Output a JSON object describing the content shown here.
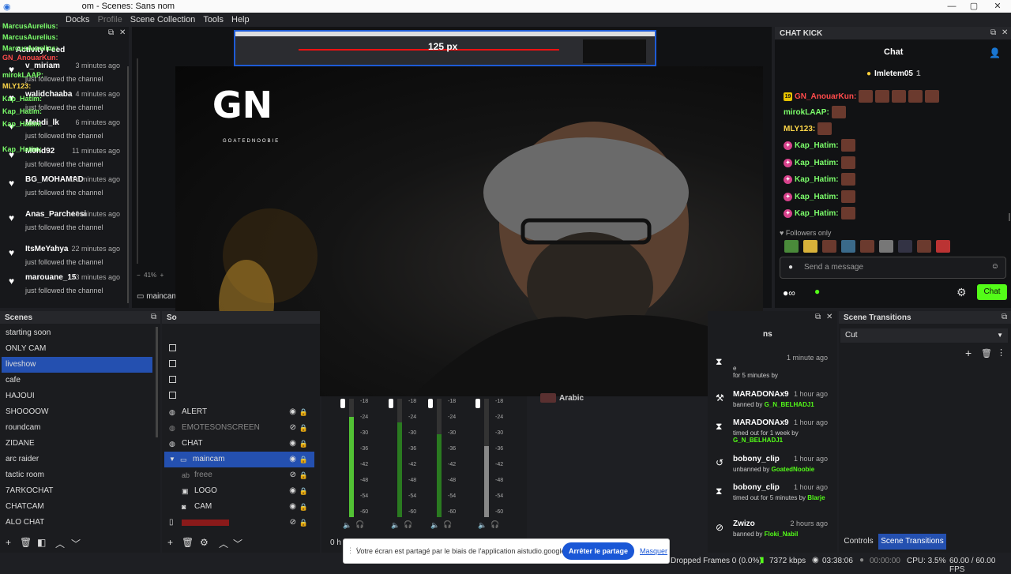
{
  "window": {
    "title": "Scenes: Sans nom",
    "title_prefix": "om - "
  },
  "menu": {
    "docks": "Docks",
    "profile": "Profile",
    "scene_collection": "Scene Collection",
    "tools": "Tools",
    "help": "Help"
  },
  "activity_feed": {
    "title": "Activity Feed",
    "items": [
      {
        "name": "v_miriam",
        "time": "3 minutes ago",
        "desc": "just followed the channel"
      },
      {
        "name": "walidchaaba",
        "time": "4 minutes ago",
        "desc": "just followed the channel"
      },
      {
        "name": "Mehdi_lk",
        "time": "6 minutes ago",
        "desc": "just followed the channel"
      },
      {
        "name": "M0hd92",
        "time": "11 minutes ago",
        "desc": "just followed the channel"
      },
      {
        "name": "BG_MOHAMAD",
        "time": "16 minutes ago",
        "desc": "just followed the channel"
      },
      {
        "name": "Anas_Parcheesi",
        "time": "19 minutes ago",
        "desc": "just followed the channel"
      },
      {
        "name": "ItsMeYahya",
        "time": "22 minutes ago",
        "desc": "just followed the channel"
      },
      {
        "name": "marouane_15",
        "time": "23 minutes ago",
        "desc": "just followed the channel"
      }
    ],
    "overlay_names": [
      "MarcusAurelius:",
      "MarcusAurelius:",
      "MarcusAurelius:",
      "GN_AnouarKun:",
      "mirokLAAP:",
      "MLY123:",
      "Kap_Hatim:",
      "Kap_Hatim:",
      "Kap_Hatim:",
      "Kap_Hatim:"
    ]
  },
  "preview": {
    "ruler_label": "125 px",
    "zoom": "41%",
    "source_label": "maincam"
  },
  "logo": {
    "letters": "GN",
    "caption": "GOATEDNOOBIE"
  },
  "chat": {
    "dock_title": "CHAT KICK",
    "header": "Chat",
    "pinned_user": "Imletem05",
    "pinned_count": "1",
    "lines": [
      {
        "badge": "19",
        "user": "GN_AnouarKun:",
        "color": "#ff4b4b",
        "emotes": 5
      },
      {
        "badge": "",
        "user": "mirokLAAP:",
        "color": "#7cff6b",
        "emotes": 1
      },
      {
        "badge": "",
        "user": "MLY123:",
        "color": "#ffd84a",
        "emotes": 1
      },
      {
        "badge": "g",
        "user": "Kap_Hatim:",
        "color": "#7cff6b",
        "emotes": 1
      },
      {
        "badge": "g",
        "user": "Kap_Hatim:",
        "color": "#7cff6b",
        "emotes": 1
      },
      {
        "badge": "g",
        "user": "Kap_Hatim:",
        "color": "#7cff6b",
        "emotes": 1
      },
      {
        "badge": "g",
        "user": "Kap_Hatim:",
        "color": "#7cff6b",
        "emotes": 1
      },
      {
        "badge": "g",
        "user": "Kap_Hatim:",
        "color": "#7cff6b",
        "emotes": 1
      }
    ],
    "followers_only": "Followers only",
    "input_placeholder": "Send a message",
    "send_label": "Chat"
  },
  "scenes": {
    "title": "Scenes",
    "items": [
      "starting soon",
      "ONLY CAM",
      "liveshow",
      "cafe",
      "HAJOUI",
      "SHOOOOW",
      "roundcam",
      "ZIDANE",
      "arc raider",
      "tactic room",
      "7ARKOCHAT",
      "CHATCAM",
      "ALO CHAT"
    ],
    "selected_index": 2
  },
  "sources": {
    "title_prefix": "So",
    "items": [
      {
        "name": "ALERT",
        "visible": true,
        "indent": 0,
        "icon": "browser-icon"
      },
      {
        "name": "EMOTESONSCREEN",
        "visible": false,
        "indent": 0,
        "icon": "browser-icon"
      },
      {
        "name": "CHAT",
        "visible": true,
        "indent": 0,
        "icon": "browser-icon"
      },
      {
        "name": "maincam",
        "visible": true,
        "indent": 0,
        "icon": "folder-icon",
        "selected": true
      },
      {
        "name": "freee",
        "visible": false,
        "indent": 1,
        "icon": "text-icon"
      },
      {
        "name": "LOGO",
        "visible": true,
        "indent": 1,
        "icon": "image-icon"
      },
      {
        "name": "CAM",
        "visible": true,
        "indent": 1,
        "icon": "camera-icon"
      }
    ]
  },
  "mixer": {
    "ticks": [
      "-18",
      "-24",
      "-30",
      "-36",
      "-42",
      "-48",
      "-54",
      "-60"
    ],
    "levels": [
      0.85,
      0.8,
      0.7,
      0.6
    ],
    "bottom_label": "0 h"
  },
  "moderation": {
    "title_suffix": "ns",
    "items": [
      {
        "icon": "hourglass-icon",
        "name": "",
        "time": "1 minute ago",
        "desc": "e",
        "by": "",
        "desc2": "for 5 minutes by"
      },
      {
        "icon": "hammer-icon",
        "name": "MARADONAx9",
        "time": "1 hour ago",
        "desc": "banned by",
        "by": "G_N_BELHADJ1"
      },
      {
        "icon": "hourglass-icon",
        "name": "MARADONAx9",
        "time": "1 hour ago",
        "desc": "timed out for 1 week by",
        "by": "G_N_BELHADJ1"
      },
      {
        "icon": "undo-icon",
        "name": "bobony_clip",
        "time": "1 hour ago",
        "desc": "unbanned by",
        "by": "GoatedNoobie"
      },
      {
        "icon": "hourglass-icon",
        "name": "bobony_clip",
        "time": "1 hour ago",
        "desc": "timed out for 5 minutes by",
        "by": "Blarje"
      },
      {
        "icon": "ban-icon",
        "name": "Zwizo",
        "time": "2 hours ago",
        "desc": "banned by",
        "by": "Floki_Nabil"
      }
    ]
  },
  "arabic_label": "Arabic",
  "transitions": {
    "title": "Scene Transitions",
    "selected": "Cut",
    "tab_controls": "Controls",
    "tab_transitions": "Scene Transitions"
  },
  "status": {
    "dropped": "Dropped Frames 0 (0.0%)",
    "bitrate": "7372 kbps",
    "live_time": "03:38:06",
    "rec_time": "00:00:00",
    "cpu": "CPU: 3.5%",
    "fps": "60.00 / 60.00 FPS"
  },
  "share_bar": {
    "text": "Votre écran est partagé par le biais de l'application aistudio.google.com.",
    "stop": "Arrêter le partage",
    "hide": "Masquer"
  }
}
